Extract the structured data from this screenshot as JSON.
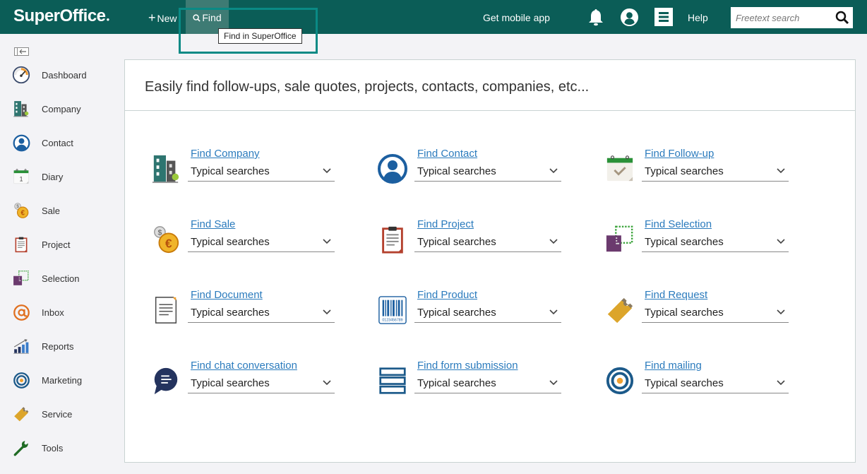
{
  "app": {
    "logo": "SuperOffice",
    "brand_color": "#0b5d57"
  },
  "topbar": {
    "new_label": "New",
    "find_label": "Find",
    "find_tooltip": "Find in SuperOffice",
    "mobile_app_label": "Get mobile app",
    "help_label": "Help",
    "search_placeholder": "Freetext search",
    "search_value": "",
    "icons": [
      "plus-icon",
      "search-icon",
      "bell-icon",
      "user-icon",
      "menu-icon",
      "search-icon"
    ]
  },
  "sidebar": {
    "collapse_icon": "collapse-sidebar-icon",
    "items": [
      {
        "label": "Dashboard",
        "icon": "dashboard-icon"
      },
      {
        "label": "Company",
        "icon": "company-icon"
      },
      {
        "label": "Contact",
        "icon": "contact-icon"
      },
      {
        "label": "Diary",
        "icon": "diary-icon"
      },
      {
        "label": "Sale",
        "icon": "sale-icon"
      },
      {
        "label": "Project",
        "icon": "project-icon"
      },
      {
        "label": "Selection",
        "icon": "selection-icon"
      },
      {
        "label": "Inbox",
        "icon": "inbox-icon"
      },
      {
        "label": "Reports",
        "icon": "reports-icon"
      },
      {
        "label": "Marketing",
        "icon": "marketing-icon"
      },
      {
        "label": "Service",
        "icon": "service-icon"
      },
      {
        "label": "Tools",
        "icon": "tools-icon"
      }
    ]
  },
  "main": {
    "heading": "Easily find follow-ups, sale quotes, projects, contacts, companies, etc...",
    "finders": [
      {
        "link": "Find Company",
        "dropdown": "Typical searches",
        "icon": "company-icon"
      },
      {
        "link": "Find Contact",
        "dropdown": "Typical searches",
        "icon": "contact-icon"
      },
      {
        "link": "Find Follow-up",
        "dropdown": "Typical searches",
        "icon": "follow-up-icon"
      },
      {
        "link": "Find Sale",
        "dropdown": "Typical searches",
        "icon": "sale-icon"
      },
      {
        "link": "Find Project",
        "dropdown": "Typical searches",
        "icon": "project-icon"
      },
      {
        "link": "Find Selection",
        "dropdown": "Typical searches",
        "icon": "selection-icon"
      },
      {
        "link": "Find Document",
        "dropdown": "Typical searches",
        "icon": "document-icon"
      },
      {
        "link": "Find Product",
        "dropdown": "Typical searches",
        "icon": "product-barcode-icon"
      },
      {
        "link": "Find Request",
        "dropdown": "Typical searches",
        "icon": "request-ticket-icon"
      },
      {
        "link": "Find chat conversation",
        "dropdown": "Typical searches",
        "icon": "chat-icon"
      },
      {
        "link": "Find form submission",
        "dropdown": "Typical searches",
        "icon": "form-icon"
      },
      {
        "link": "Find mailing",
        "dropdown": "Typical searches",
        "icon": "mailing-target-icon"
      }
    ]
  }
}
